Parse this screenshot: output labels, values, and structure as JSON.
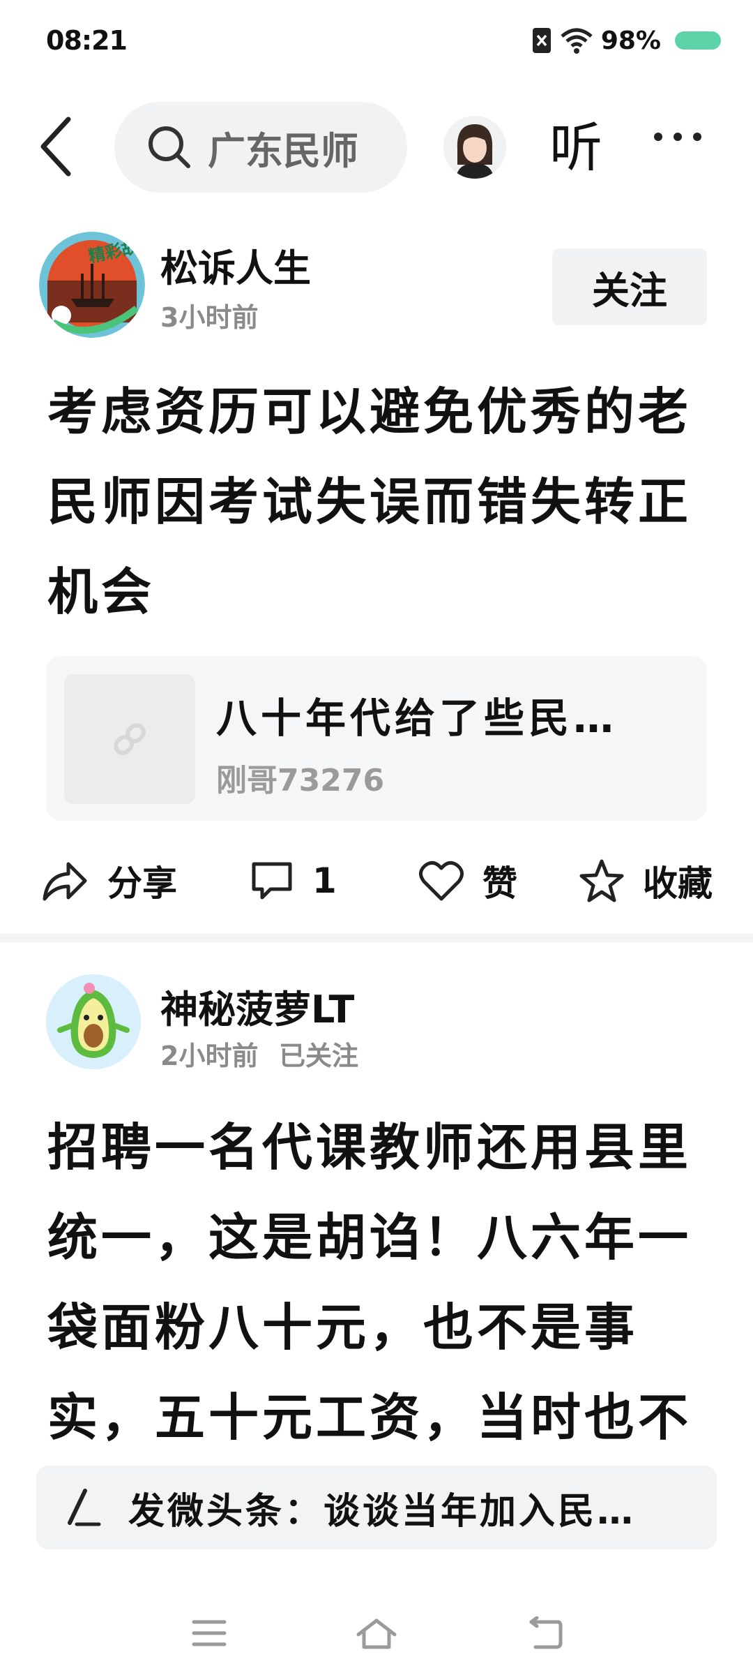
{
  "status": {
    "time": "08:21",
    "battery": "98%"
  },
  "header": {
    "search_text": "广东民师",
    "listen_label": "听"
  },
  "post1": {
    "author": "松诉人生",
    "avatar_badge": "精彩故事",
    "time": "3小时前",
    "follow_label": "关注",
    "title_lines": [
      "考虑资历可以避免优秀的老",
      "民师因考试失误而错失转正",
      "机会"
    ],
    "link_title": "八十年代给了些民…",
    "link_author": "刚哥73276",
    "actions": {
      "share": "分享",
      "comment_count": "1",
      "like": "赞",
      "collect": "收藏"
    }
  },
  "post2": {
    "author": "神秘菠萝LT",
    "time": "2小时前",
    "follow_state": "已关注",
    "body_lines": [
      "招聘一名代课教师还用县里",
      "统一，这是胡诌！八六年一",
      "袋面粉八十元，也不是事",
      "实，五十元工资，当时也不"
    ]
  },
  "compose": {
    "label": "发微头条：谈谈当年加入民…"
  },
  "colors": {
    "battery": "#5fd3a8",
    "card_bg": "#f5f6f8",
    "muted": "#8a8a8a"
  }
}
